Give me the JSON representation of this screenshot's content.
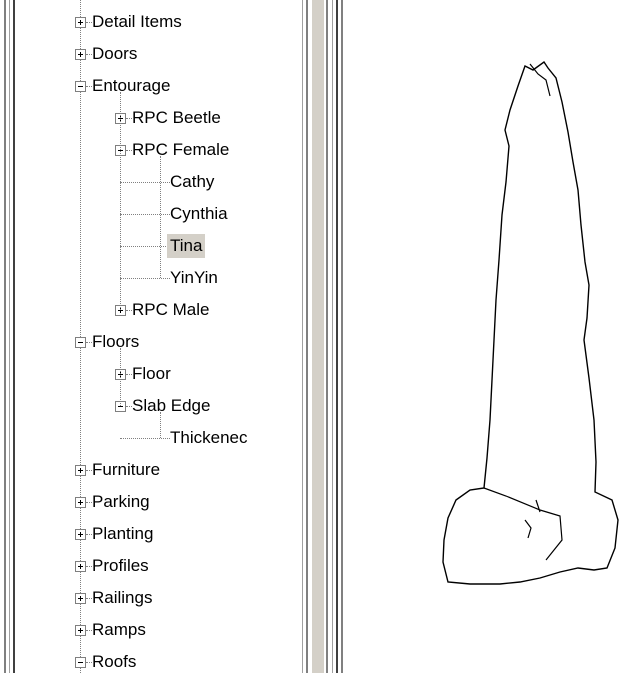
{
  "tree": {
    "items": [
      {
        "label": "Detail Items",
        "state": "collapsed",
        "depth": 0
      },
      {
        "label": "Doors",
        "state": "collapsed",
        "depth": 0
      },
      {
        "label": "Entourage",
        "state": "expanded",
        "depth": 0
      },
      {
        "label": "RPC Beetle",
        "state": "collapsed",
        "depth": 1
      },
      {
        "label": "RPC Female",
        "state": "expanded",
        "depth": 1
      },
      {
        "label": "Cathy",
        "state": "leaf",
        "depth": 2
      },
      {
        "label": "Cynthia",
        "state": "leaf",
        "depth": 2
      },
      {
        "label": "Tina",
        "state": "leaf",
        "depth": 2,
        "selected": true
      },
      {
        "label": "YinYin",
        "state": "leaf",
        "depth": 2
      },
      {
        "label": "RPC Male",
        "state": "collapsed",
        "depth": 1
      },
      {
        "label": "Floors",
        "state": "expanded",
        "depth": 0
      },
      {
        "label": "Floor",
        "state": "collapsed",
        "depth": 1
      },
      {
        "label": "Slab Edge",
        "state": "expanded",
        "depth": 1
      },
      {
        "label": "Thickenec",
        "state": "leaf",
        "depth": 2
      },
      {
        "label": "Furniture",
        "state": "collapsed",
        "depth": 0
      },
      {
        "label": "Parking",
        "state": "collapsed",
        "depth": 0
      },
      {
        "label": "Planting",
        "state": "collapsed",
        "depth": 0
      },
      {
        "label": "Profiles",
        "state": "collapsed",
        "depth": 0
      },
      {
        "label": "Railings",
        "state": "collapsed",
        "depth": 0
      },
      {
        "label": "Ramps",
        "state": "collapsed",
        "depth": 0
      },
      {
        "label": "Roofs",
        "state": "expanded",
        "depth": 0
      }
    ]
  },
  "colors": {
    "selection_background": "#d4d0c8",
    "tree_lines": "#808080",
    "frame": "#808080"
  },
  "icons": {
    "expand": "plus-box-icon",
    "collapse": "minus-box-icon"
  },
  "preview": {
    "content": "rpc-female-outline"
  }
}
